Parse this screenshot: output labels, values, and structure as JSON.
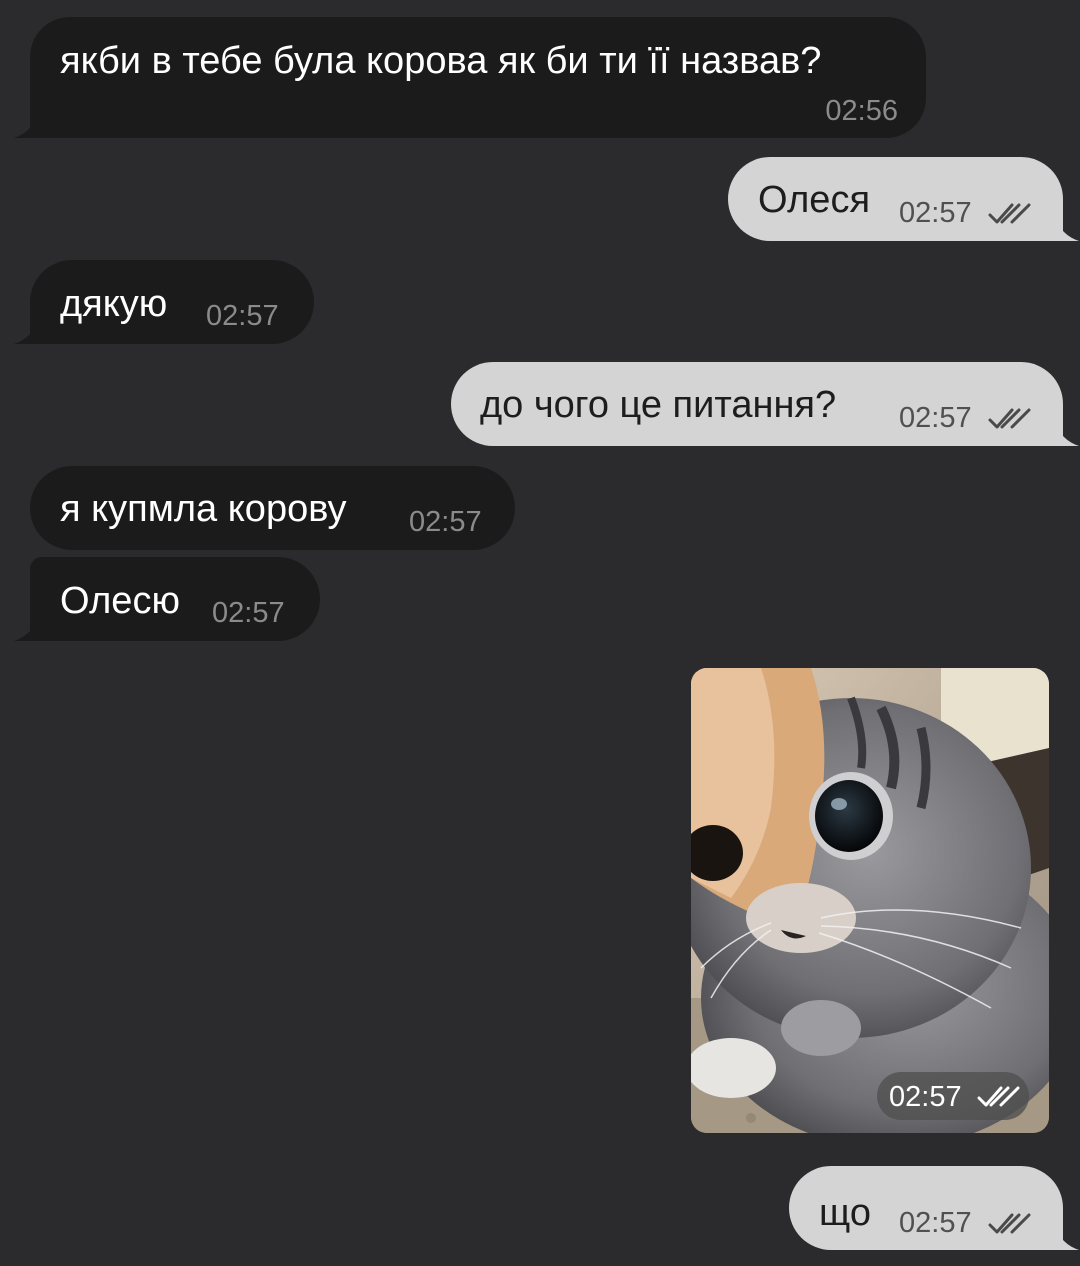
{
  "colors": {
    "background": "#2b2b2d",
    "incoming_bubble": "#1b1b1b",
    "outgoing_bubble": "#d4d4d4"
  },
  "messages": [
    {
      "direction": "incoming",
      "text": "якби в тебе була корова як би ти її назвав?",
      "time": "02:56"
    },
    {
      "direction": "outgoing",
      "text": "Олеся",
      "time": "02:57",
      "status_icon": "double-check-icon"
    },
    {
      "direction": "incoming",
      "text": "дякую",
      "time": "02:57"
    },
    {
      "direction": "outgoing",
      "text": "до чого це питання?",
      "time": "02:57",
      "status_icon": "double-check-icon"
    },
    {
      "direction": "incoming",
      "text": "я купмла корову",
      "time": "02:57"
    },
    {
      "direction": "incoming",
      "text": "Олесю",
      "time": "02:57"
    },
    {
      "direction": "outgoing",
      "type": "photo",
      "time": "02:57",
      "status_icon": "double-check-icon"
    },
    {
      "direction": "outgoing",
      "text": "що",
      "time": "02:57",
      "status_icon": "double-check-icon"
    }
  ]
}
